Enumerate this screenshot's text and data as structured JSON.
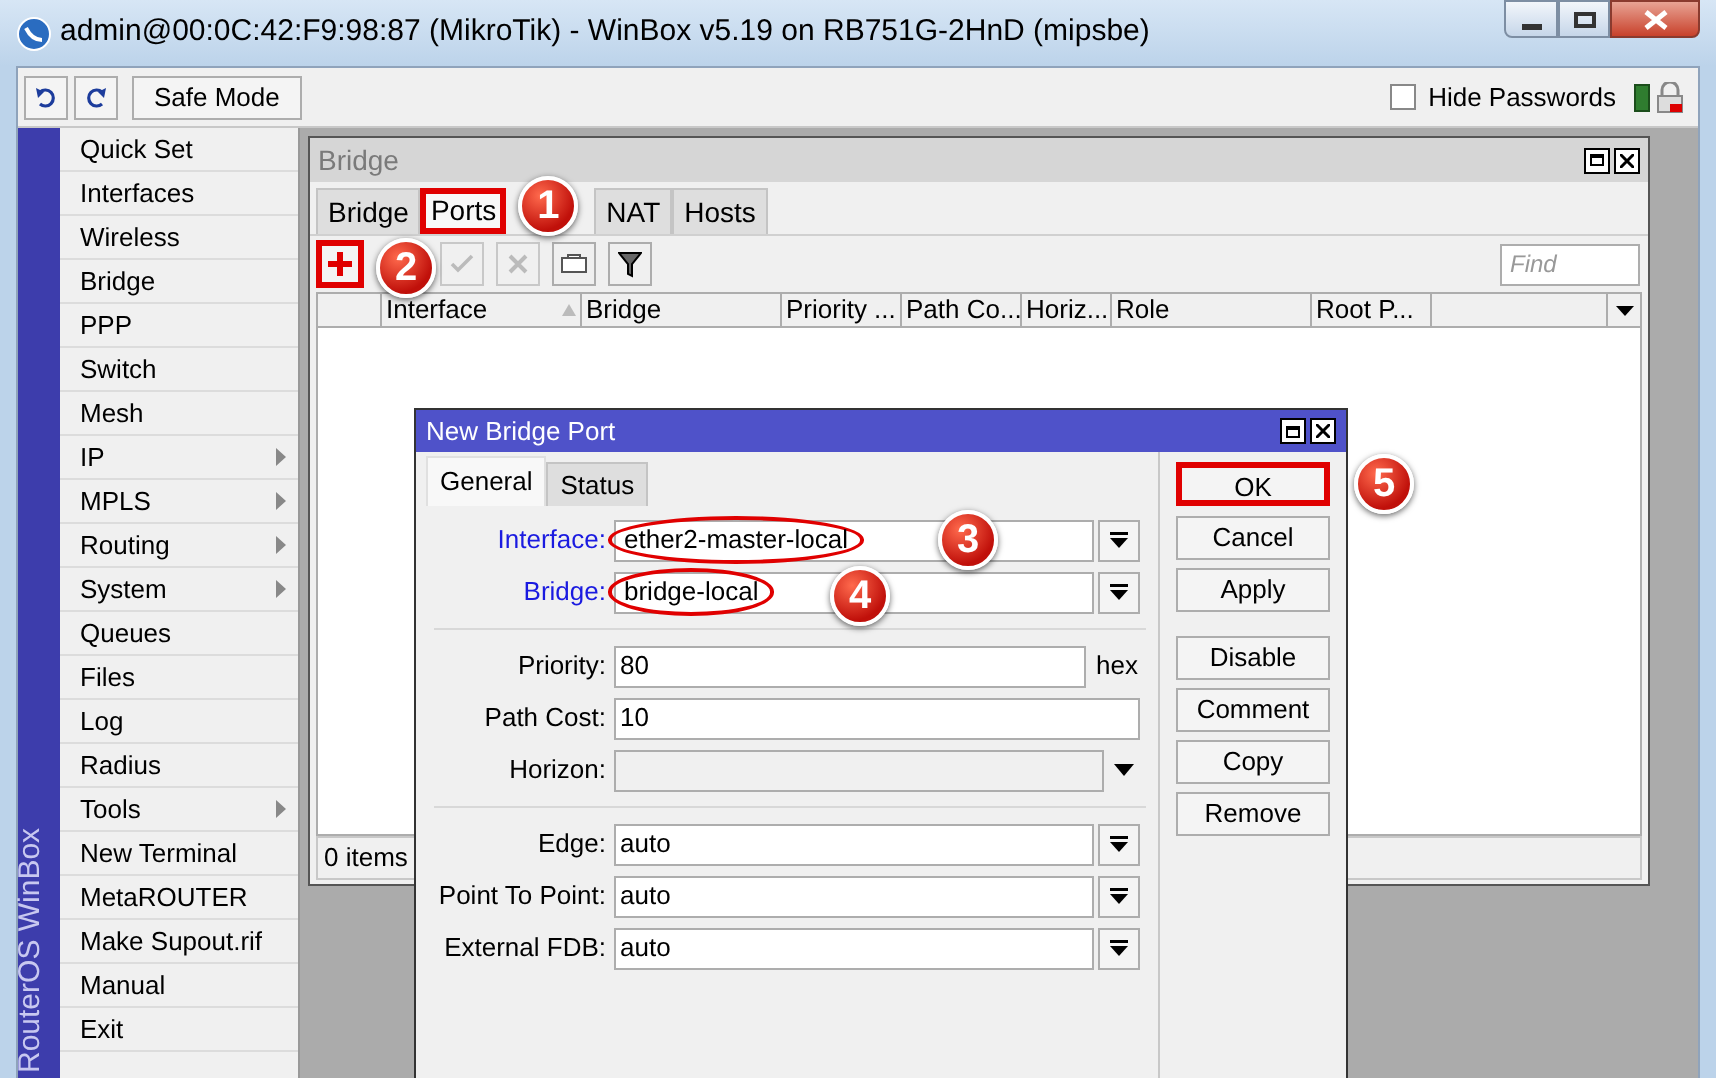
{
  "window": {
    "title": "admin@00:0C:42:F9:98:87 (MikroTik) - WinBox v5.19 on RB751G-2HnD (mipsbe)"
  },
  "toolbar": {
    "safe_mode": "Safe Mode",
    "hide_passwords": {
      "label": "Hide Passwords",
      "checked": false
    }
  },
  "sidebar": {
    "label": "RouterOS WinBox",
    "items": [
      {
        "label": "Quick Set",
        "submenu": false
      },
      {
        "label": "Interfaces",
        "submenu": false
      },
      {
        "label": "Wireless",
        "submenu": false
      },
      {
        "label": "Bridge",
        "submenu": false
      },
      {
        "label": "PPP",
        "submenu": false
      },
      {
        "label": "Switch",
        "submenu": false
      },
      {
        "label": "Mesh",
        "submenu": false
      },
      {
        "label": "IP",
        "submenu": true
      },
      {
        "label": "MPLS",
        "submenu": true
      },
      {
        "label": "Routing",
        "submenu": true
      },
      {
        "label": "System",
        "submenu": true
      },
      {
        "label": "Queues",
        "submenu": false
      },
      {
        "label": "Files",
        "submenu": false
      },
      {
        "label": "Log",
        "submenu": false
      },
      {
        "label": "Radius",
        "submenu": false
      },
      {
        "label": "Tools",
        "submenu": true
      },
      {
        "label": "New Terminal",
        "submenu": false
      },
      {
        "label": "MetaROUTER",
        "submenu": false
      },
      {
        "label": "Make Supout.rif",
        "submenu": false
      },
      {
        "label": "Manual",
        "submenu": false
      },
      {
        "label": "Exit",
        "submenu": false
      }
    ]
  },
  "bridge_window": {
    "title": "Bridge",
    "tabs": [
      {
        "label": "Bridge",
        "selected": false,
        "highlighted": false
      },
      {
        "label": "Ports",
        "selected": true,
        "highlighted": true,
        "badge": "1"
      },
      {
        "label": "NAT",
        "selected": false,
        "highlighted": false
      },
      {
        "label": "Hosts",
        "selected": false,
        "highlighted": false
      }
    ],
    "add_button": {
      "highlighted": true,
      "badge": "2"
    },
    "find": {
      "placeholder": "Find"
    },
    "columns": [
      "",
      "Interface",
      "Bridge",
      "Priority ...",
      "Path Co...",
      "Horiz...",
      "Role",
      "Root P..."
    ],
    "status": "0 items"
  },
  "dialog": {
    "title": "New Bridge Port",
    "tabs": [
      {
        "label": "General",
        "selected": true
      },
      {
        "label": "Status",
        "selected": false
      }
    ],
    "fields": [
      {
        "kind": "select",
        "label": "Interface:",
        "value": "ether2-master-local",
        "link": true,
        "circled": true,
        "badge": "3"
      },
      {
        "kind": "select",
        "label": "Bridge:",
        "value": "bridge-local",
        "link": true,
        "circled": true,
        "badge": "4"
      },
      {
        "kind": "divider"
      },
      {
        "kind": "text",
        "label": "Priority:",
        "value": "80",
        "suffix": "hex"
      },
      {
        "kind": "text",
        "label": "Path Cost:",
        "value": "10"
      },
      {
        "kind": "combo",
        "label": "Horizon:"
      },
      {
        "kind": "divider"
      },
      {
        "kind": "select",
        "label": "Edge:",
        "value": "auto"
      },
      {
        "kind": "select",
        "label": "Point To Point:",
        "value": "auto"
      },
      {
        "kind": "select",
        "label": "External FDB:",
        "value": "auto"
      }
    ],
    "button_groups": [
      [
        {
          "label": "OK",
          "highlighted": true,
          "badge": "5"
        },
        {
          "label": "Cancel",
          "highlighted": false
        },
        {
          "label": "Apply",
          "highlighted": false
        }
      ],
      [
        {
          "label": "Disable",
          "highlighted": false
        },
        {
          "label": "Comment",
          "highlighted": false
        },
        {
          "label": "Copy",
          "highlighted": false
        },
        {
          "label": "Remove",
          "highlighted": false
        }
      ]
    ]
  }
}
